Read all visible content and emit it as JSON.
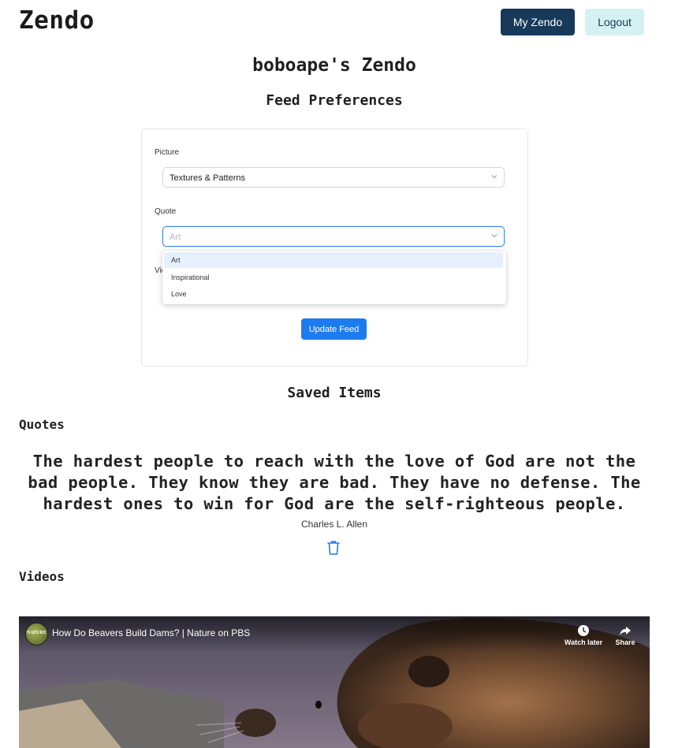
{
  "header": {
    "brand": "Zendo",
    "my_zendo_label": "My Zendo",
    "logout_label": "Logout"
  },
  "page_title": "boboape's Zendo",
  "feed_preferences": {
    "heading": "Feed Preferences",
    "picture_label": "Picture",
    "picture_value": "Textures & Patterns",
    "quote_label": "Quote",
    "quote_placeholder": "Art",
    "quote_options": [
      "Art",
      "Inspirational",
      "Love"
    ],
    "video_label_partial": "Vid",
    "update_button": "Update Feed"
  },
  "saved_items": {
    "heading": "Saved Items",
    "quotes_heading": "Quotes",
    "quote": {
      "text": "The hardest people to reach with the love of God are not the bad people. They know they are bad. They have no defense. The hardest ones to win for God are the self-righteous people.",
      "author": "Charles L. Allen"
    },
    "videos_heading": "Videos",
    "video": {
      "title": "How Do Beavers Build Dams? | Nature on PBS",
      "channel_logo_text": "NATURE",
      "watch_later": "Watch later",
      "share": "Share"
    }
  },
  "colors": {
    "primary_dark": "#17395a",
    "logout_bg": "#d4f1f4",
    "button_blue": "#1d7bf0",
    "focus_border": "#3b82f6",
    "option_highlight": "#e6f0fd"
  },
  "icons": {
    "select_chevron": "chevron-down-icon",
    "delete": "trash-icon",
    "watch_later": "clock-icon",
    "share": "share-arrow-icon"
  }
}
